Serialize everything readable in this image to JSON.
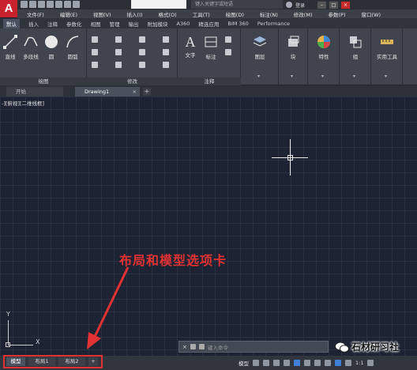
{
  "app": {
    "logo": "A"
  },
  "titlebar": {
    "search_placeholder": "键入关键字或短语",
    "login_label": "登录",
    "minimize": "–",
    "restore": "□",
    "close": "×"
  },
  "menu": [
    "文件(F)",
    "编辑(E)",
    "视图(V)",
    "插入(I)",
    "格式(O)",
    "工具(T)",
    "绘图(D)",
    "标注(N)",
    "修改(M)",
    "参数(P)",
    "窗口(W)"
  ],
  "ribbon_tabs": [
    "默认",
    "插入",
    "注释",
    "参数化",
    "视图",
    "管理",
    "输出",
    "附加模块",
    "A360",
    "精选应用",
    "BIM 360",
    "Performance"
  ],
  "ribbon_active_tab": "默认",
  "ribbon": {
    "draw_tools": [
      "直线",
      "多段线",
      "圆",
      "圆弧"
    ],
    "draw_panel": "绘图",
    "modify_panel": "修改",
    "annotation_tools": [
      "文字",
      "标注"
    ],
    "annotation_panel": "注释",
    "layers": "图层",
    "block": "块",
    "properties": "特性",
    "group": "组",
    "utilities": "实用工具"
  },
  "file_tabs": {
    "start": "开始",
    "drawing": "Drawing1",
    "add": "+"
  },
  "viewport_label": "-][俯视][二维线框]",
  "annotation_text": "布局和模型选项卡",
  "ucs": {
    "x": "X",
    "y": "Y"
  },
  "command_line": {
    "placeholder": "键入命令",
    "close": "×"
  },
  "layout_tabs": [
    "模型",
    "布局1",
    "布局2",
    "+"
  ],
  "status": {
    "model": "模型",
    "scale": "1:1"
  },
  "watermark": "石材研习社",
  "colors": {
    "accent_red": "#e03232",
    "logo_red": "#c8232c",
    "canvas": "#1d2333"
  }
}
